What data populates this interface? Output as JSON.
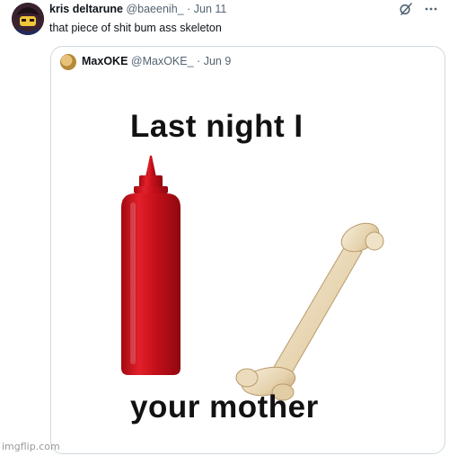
{
  "tweet": {
    "display_name": "kris deltarune",
    "handle": "@baeenih_",
    "separator": "·",
    "date": "Jun 11",
    "text": "that piece of shit bum ass skeleton"
  },
  "quoted_tweet": {
    "display_name": "MaxOKE",
    "handle": "@MaxOKE_",
    "separator": "·",
    "date": "Jun 9",
    "meme": {
      "top_text": "Last night I",
      "bottom_text": "your mother",
      "left_image": "ketchup-bottle",
      "right_image": "femur-bone"
    }
  },
  "icons": {
    "grok": "grok-icon",
    "more": "more-icon"
  },
  "watermark": "imgflip.com",
  "colors": {
    "muted_text": "#536471",
    "border": "#cfd9de",
    "ketchup_red": "#d40f1c"
  }
}
